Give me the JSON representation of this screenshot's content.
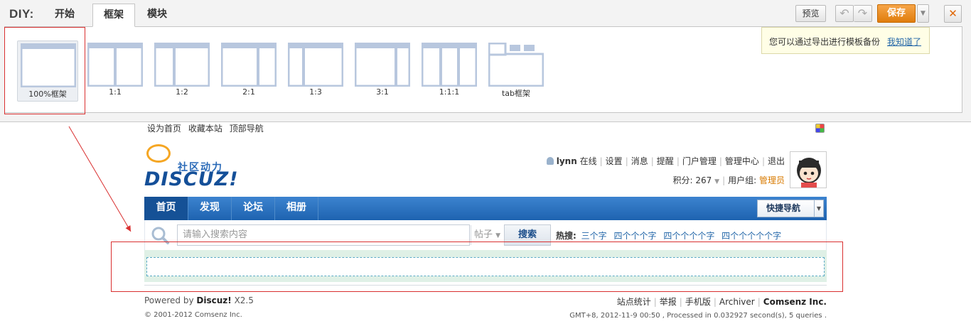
{
  "diy": {
    "label": "DIY:",
    "tabs": {
      "start": "开始",
      "frame": "框架",
      "module": "模块"
    },
    "buttons": {
      "preview": "预览",
      "save": "保存"
    },
    "tip": {
      "text": "您可以通过导出进行模板备份",
      "link": "我知道了"
    },
    "layouts": [
      "100%框架",
      "1:1",
      "1:2",
      "2:1",
      "1:3",
      "3:1",
      "1:1:1",
      "tab框架"
    ],
    "selected_layout": "100%框架"
  },
  "page": {
    "topbar": [
      "设为首页",
      "收藏本站",
      "顶部导航"
    ],
    "logo": {
      "tagline": "社区动力",
      "brand": "DISCUZ!"
    },
    "user": {
      "name": "lynn",
      "status": "在线",
      "links": [
        "设置",
        "消息",
        "提醒",
        "门户管理",
        "管理中心",
        "退出"
      ],
      "score_label": "积分: 267",
      "group_label": "用户组:",
      "group": "管理员"
    },
    "nav": {
      "items": [
        "首页",
        "发现",
        "论坛",
        "相册"
      ],
      "active": "首页",
      "quick": "快捷导航"
    },
    "search": {
      "placeholder": "请输入搜索内容",
      "type": "帖子",
      "button": "搜索",
      "hot_label": "热搜:",
      "hot": [
        "三个字",
        "四个个个字",
        "四个个个个字",
        "四个个个个个字"
      ]
    },
    "footer": {
      "powered_prefix": "Powered by",
      "powered_brand": "Discuz!",
      "powered_version": "X2.5",
      "copyright": "© 2001-2012 Comsenz Inc.",
      "links": [
        "站点统计",
        "举报",
        "手机版",
        "Archiver"
      ],
      "company": "Comsenz Inc.",
      "info": "GMT+8, 2012-11-9 00:50 , Processed in 0.032927 second(s), 5 queries ."
    }
  },
  "colors": {
    "accent_orange": "#e07d0c",
    "nav_blue": "#1e63b0",
    "annotation_red": "#d93030",
    "link_blue": "#2366a8"
  }
}
